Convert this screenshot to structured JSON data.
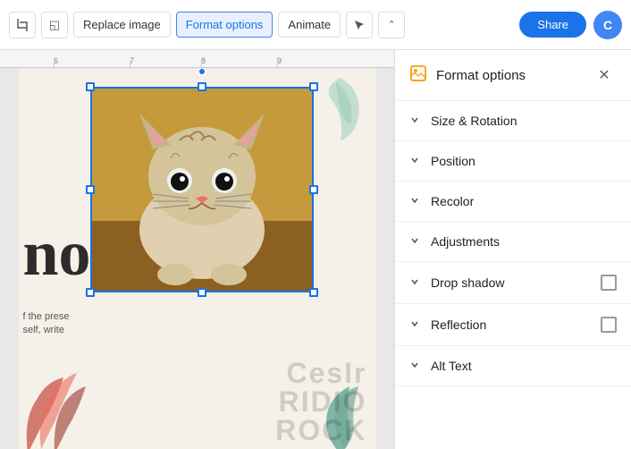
{
  "toolbar": {
    "replace_image_label": "Replace image",
    "format_options_label": "Format options",
    "animate_label": "Animate",
    "share_label": "Share",
    "avatar_initials": "C"
  },
  "format_panel": {
    "title": "Format options",
    "close_label": "✕",
    "icon": "🖼",
    "items": [
      {
        "id": "size-rotation",
        "label": "Size & Rotation",
        "has_checkbox": false
      },
      {
        "id": "position",
        "label": "Position",
        "has_checkbox": false
      },
      {
        "id": "recolor",
        "label": "Recolor",
        "has_checkbox": false
      },
      {
        "id": "adjustments",
        "label": "Adjustments",
        "has_checkbox": false
      },
      {
        "id": "drop-shadow",
        "label": "Drop shadow",
        "has_checkbox": true
      },
      {
        "id": "reflection",
        "label": "Reflection",
        "has_checkbox": true
      },
      {
        "id": "alt-text",
        "label": "Alt Text",
        "has_checkbox": false
      }
    ]
  },
  "slide": {
    "large_text": "no",
    "body_text": "f the prese self, write"
  },
  "watermark": {
    "line1": "CesIr",
    "line2": "RIDIO",
    "line3": "ROCK"
  },
  "ruler": {
    "marks": [
      "6",
      "7",
      "8",
      "9"
    ]
  }
}
